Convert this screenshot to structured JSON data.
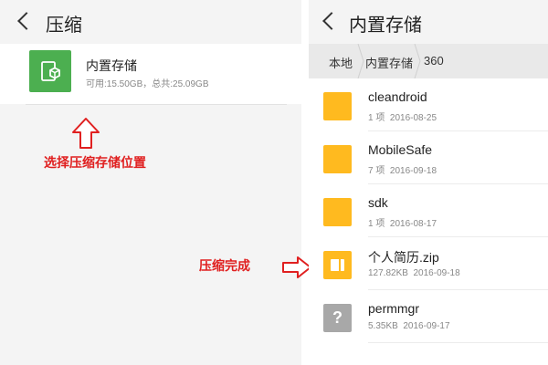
{
  "left_screen": {
    "title": "压缩",
    "storage": {
      "name": "内置存储",
      "info": "可用:15.50GB，总共:25.09GB",
      "icon": "storage-drive-icon"
    },
    "annotation_select": "选择压缩存储位置",
    "annotation_done": "压缩完成"
  },
  "right_screen": {
    "title": "内置存储",
    "breadcrumb": [
      "本地",
      "内置存储",
      "360"
    ],
    "files": [
      {
        "name": "cleandroid",
        "count": "1 项",
        "date": "2016-08-25",
        "type": "folder"
      },
      {
        "name": "MobileSafe",
        "count": "7 项",
        "date": "2016-09-18",
        "type": "folder"
      },
      {
        "name": "sdk",
        "count": "1 项",
        "date": "2016-08-17",
        "type": "folder"
      },
      {
        "name": "个人简历.zip",
        "count": "127.82KB",
        "date": "2016-09-18",
        "type": "zip"
      },
      {
        "name": "permmgr",
        "count": "5.35KB",
        "date": "2016-09-17",
        "type": "unknown"
      }
    ],
    "unknown_glyph": "?"
  },
  "colors": {
    "accent_red": "#e02020",
    "folder_yellow": "#ffba1f",
    "storage_green": "#4caf50"
  }
}
